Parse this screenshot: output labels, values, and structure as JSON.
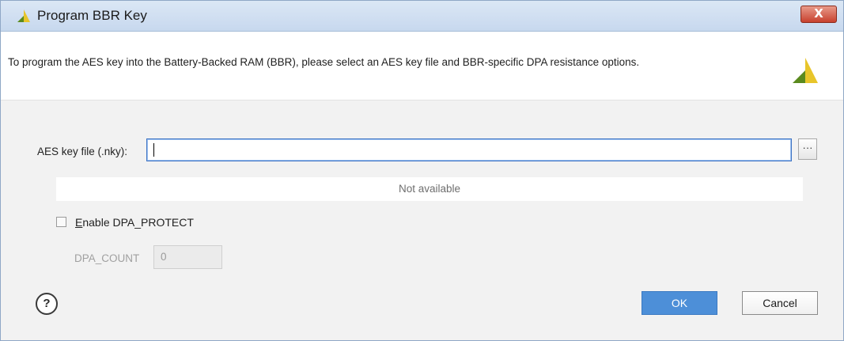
{
  "window": {
    "title": "Program BBR Key",
    "close_label": "X",
    "title_icon": "xilinx-logo-icon"
  },
  "header": {
    "message": "To program the AES key into the Battery-Backed RAM (BBR), please select an AES key file and BBR-specific DPA resistance options.",
    "logo_icon": "xilinx-logo-icon"
  },
  "form": {
    "key_file_label": "AES key file (.nky):",
    "key_file_value": "",
    "browse_label": "···",
    "status_text": "Not available",
    "enable_dpa": {
      "mnemonic": "E",
      "label_rest": "nable DPA_PROTECT",
      "checked": false
    },
    "dpa_count_label": "DPA_COUNT",
    "dpa_count_value": "0"
  },
  "footer": {
    "help_label": "?",
    "ok_label": "OK",
    "cancel_label": "Cancel"
  },
  "colors": {
    "accent": "#4d8fd8",
    "titlebar": "#c7d8ee",
    "close": "#c8412e",
    "logo_dark": "#5a8a1e",
    "logo_light": "#e8c52a"
  }
}
